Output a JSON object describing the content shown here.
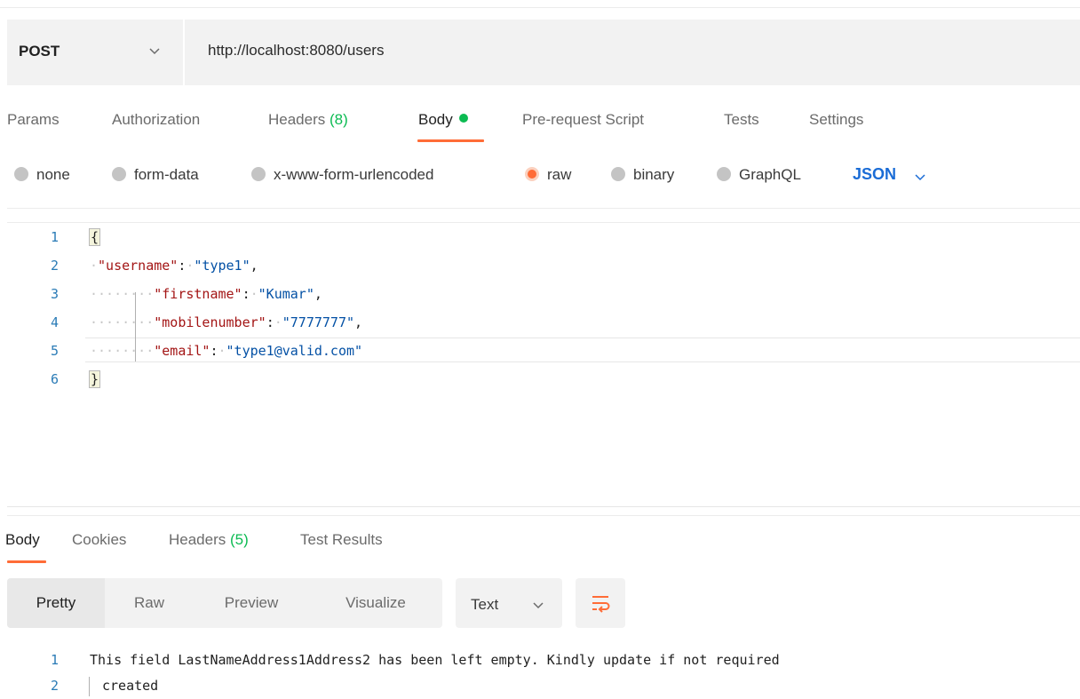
{
  "request": {
    "method": "POST",
    "url": "http://localhost:8080/users"
  },
  "request_tabs": {
    "params": "Params",
    "authorization": "Authorization",
    "headers": "Headers",
    "headers_count": "(8)",
    "body": "Body",
    "pre_request": "Pre-request Script",
    "tests": "Tests",
    "settings": "Settings",
    "active": "Body"
  },
  "body_types": {
    "none": "none",
    "form_data": "form-data",
    "urlencoded": "x-www-form-urlencoded",
    "raw": "raw",
    "binary": "binary",
    "graphql": "GraphQL",
    "selected": "raw",
    "format": "JSON"
  },
  "editor": {
    "line_numbers": [
      "1",
      "2",
      "3",
      "4",
      "5",
      "6"
    ],
    "open_brace": "{",
    "close_brace": "}",
    "lines": [
      {
        "key": "\"username\"",
        "value": "\"type1\""
      },
      {
        "key": "\"firstname\"",
        "value": "\"Kumar\""
      },
      {
        "key": "\"mobilenumber\"",
        "value": "\"7777777\""
      },
      {
        "key": "\"email\"",
        "value": "\"type1@valid.com\""
      }
    ]
  },
  "response_tabs": {
    "body": "Body",
    "cookies": "Cookies",
    "headers": "Headers",
    "headers_count": "(5)",
    "test_results": "Test Results",
    "active": "Body"
  },
  "response_view": {
    "pretty": "Pretty",
    "raw": "Raw",
    "preview": "Preview",
    "visualize": "Visualize",
    "active": "Pretty",
    "format": "Text"
  },
  "response_body": {
    "line_numbers": [
      "1",
      "2"
    ],
    "lines": [
      "This field LastNameAddress1Address2 has been left empty. Kindly update if not required",
      "created"
    ]
  },
  "colors": {
    "accent": "#ff6c37",
    "success": "#0cbb52",
    "link": "#1a6cd6"
  },
  "icons": {
    "method_dropdown": "chevron-down-icon",
    "format_dropdown": "chevron-down-icon",
    "wrap": "wrap-lines-icon"
  }
}
